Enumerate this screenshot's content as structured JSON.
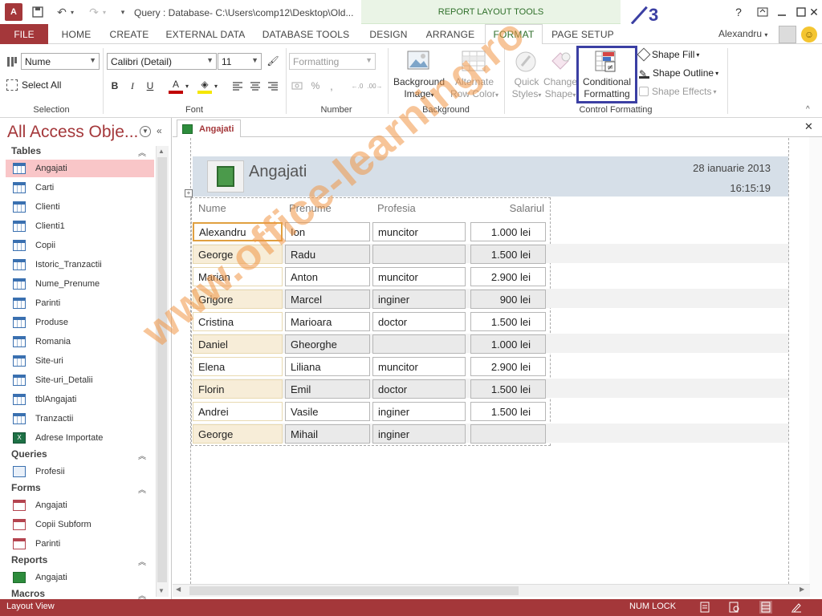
{
  "titlebar": {
    "app_icon": "A",
    "title": "Query : Database- C:\\Users\\comp12\\Desktop\\Old...",
    "context_label": "REPORT LAYOUT TOOLS",
    "help": "?",
    "icons": {
      "save": "save-icon",
      "undo": "undo-icon",
      "redo": "redo-icon",
      "customize": "customize-qat-icon"
    }
  },
  "tabs": {
    "file": "FILE",
    "items": [
      "HOME",
      "CREATE",
      "EXTERNAL DATA",
      "DATABASE TOOLS",
      "DESIGN",
      "ARRANGE",
      "FORMAT",
      "PAGE SETUP"
    ],
    "active": "FORMAT",
    "user": "Alexandru"
  },
  "ribbon": {
    "selection": {
      "combo_value": "Nume",
      "select_all": "Select All",
      "group_label": "Selection"
    },
    "font": {
      "family": "Calibri (Detail)",
      "size": "11",
      "bold": "B",
      "italic": "I",
      "underline": "U",
      "font_color": "A",
      "group_label": "Font"
    },
    "number": {
      "format": "Formatting",
      "percent": "%",
      "group_label": "Number"
    },
    "background": {
      "background_image": [
        "Background",
        "Image"
      ],
      "alternate_row": [
        "Alternate",
        "Row Color"
      ],
      "group_label": "Background"
    },
    "control_formatting": {
      "quick_styles": [
        "Quick",
        "Styles"
      ],
      "change_shape": [
        "Change",
        "Shape"
      ],
      "conditional": [
        "Conditional",
        "Formatting"
      ],
      "shape_fill": "Shape Fill",
      "shape_outline": "Shape Outline",
      "shape_effects": "Shape Effects",
      "group_label": "Control Formatting"
    },
    "step_annotation": "3"
  },
  "nav": {
    "title": "All Access Obje...",
    "groups": [
      {
        "name": "Tables",
        "items": [
          "Angajati",
          "Carti",
          "Clienti",
          "Clienti1",
          "Copii",
          "Istoric_Tranzactii",
          "Nume_Prenume",
          "Parinti",
          "Produse",
          "Romania",
          "Site-uri",
          "Site-uri_Detalii",
          "tblAngajati",
          "Tranzactii",
          "Adrese Importate"
        ]
      },
      {
        "name": "Queries",
        "items": [
          "Profesii"
        ]
      },
      {
        "name": "Forms",
        "items": [
          "Angajati",
          "Copii Subform",
          "Parinti"
        ]
      },
      {
        "name": "Reports",
        "items": [
          "Angajati"
        ]
      },
      {
        "name": "Macros",
        "items": []
      }
    ]
  },
  "document": {
    "tab": "Angajati",
    "report_title": "Angajati",
    "date": "28 ianuarie 2013",
    "time": "16:15:19",
    "columns": [
      "Nume",
      "Prenume",
      "Profesia",
      "Salariul"
    ],
    "rows": [
      [
        "Alexandru",
        "Ion",
        "muncitor",
        "1.000 lei"
      ],
      [
        "George",
        "Radu",
        "",
        "1.500 lei"
      ],
      [
        "Marian",
        "Anton",
        "muncitor",
        "2.900 lei"
      ],
      [
        "Grigore",
        "Marcel",
        "inginer",
        "900 lei"
      ],
      [
        "Cristina",
        "Marioara",
        "doctor",
        "1.500 lei"
      ],
      [
        "Daniel",
        "Gheorghe",
        "",
        "1.000 lei"
      ],
      [
        "Elena",
        "Liliana",
        "muncitor",
        "2.900 lei"
      ],
      [
        "Florin",
        "Emil",
        "doctor",
        "1.500 lei"
      ],
      [
        "Andrei",
        "Vasile",
        "inginer",
        "1.500 lei"
      ],
      [
        "George",
        "Mihail",
        "inginer",
        ""
      ]
    ]
  },
  "status": {
    "view": "Layout View",
    "numlock": "NUM LOCK"
  },
  "watermark": "www.office-learning.ro",
  "colors": {
    "access_red": "#a4373a",
    "context_green": "#2f6f2a",
    "highlight_blue": "#3b3fa3",
    "selected_nav": "#f9c6c8",
    "header_band": "#d6dfe8"
  }
}
